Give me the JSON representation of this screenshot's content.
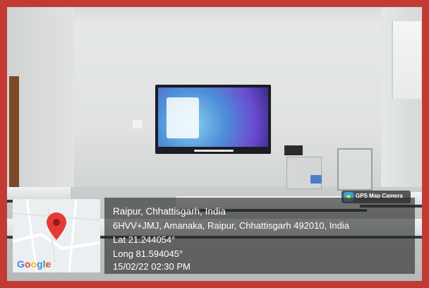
{
  "badge": {
    "label": "GPS Map Camera",
    "icon": "map-camera-icon"
  },
  "location": {
    "city_line": "Raipur, Chhattisgarh, India",
    "address": "6HVV+JMJ, Amanaka, Raipur, Chhattisgarh 492010, India",
    "lat": "Lat 21.244054°",
    "long": "Long 81.594045°",
    "datetime": "15/02/22 02:30 PM"
  },
  "map": {
    "logo": "Google",
    "pin_icon": "map-pin-icon",
    "pin_color": "#e53935"
  },
  "colors": {
    "border": "#c33a35",
    "overlay": "#2a2a2a"
  }
}
